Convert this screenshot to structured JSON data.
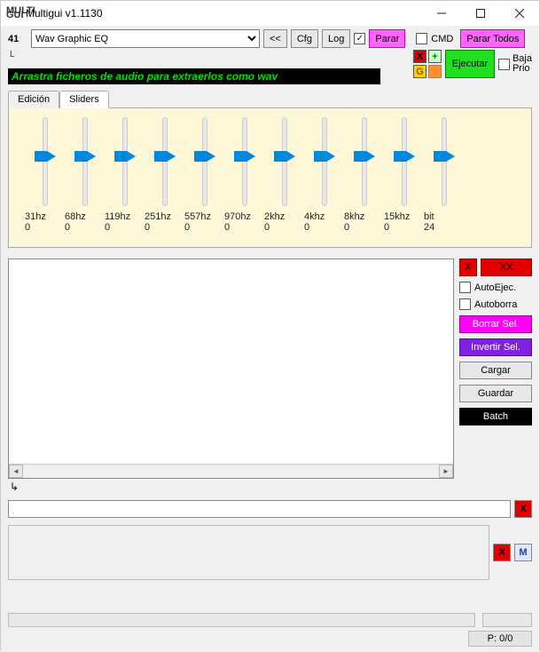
{
  "window": {
    "title": "Multigui v1.1130"
  },
  "top": {
    "num": "41",
    "preset": "Wav Graphic EQ",
    "back": "<<",
    "cfg": "Cfg",
    "log": "Log",
    "parar": "Parar",
    "cmd": "CMD",
    "parar_todos": "Parar Todos",
    "l": "L",
    "banner": "Arrastra ficheros de audio para extraerlos como wav",
    "ejecutar": "Ejecutar",
    "baja": "Baja",
    "prio": "Prio",
    "g": "G",
    "plus": "+",
    "x": "X"
  },
  "tabs": {
    "edicion": "Edición",
    "sliders": "Sliders"
  },
  "sliders": [
    {
      "freq": "31hz",
      "val": "0"
    },
    {
      "freq": "68hz",
      "val": "0"
    },
    {
      "freq": "119hz",
      "val": "0"
    },
    {
      "freq": "251hz",
      "val": "0"
    },
    {
      "freq": "557hz",
      "val": "0"
    },
    {
      "freq": "970hz",
      "val": "0"
    },
    {
      "freq": "2khz",
      "val": "0"
    },
    {
      "freq": "4khz",
      "val": "0"
    },
    {
      "freq": "8khz",
      "val": "0"
    },
    {
      "freq": "15khz",
      "val": "0"
    },
    {
      "freq": "bit",
      "val": "24"
    }
  ],
  "side": {
    "x": "X",
    "xx": "XX",
    "autoejec": "AutoEjec.",
    "autoborra": "Autoborra",
    "borrar": "Borrar Sel.",
    "invertir": "Invertir Sel.",
    "cargar": "Cargar",
    "guardar": "Guardar",
    "batch": "Batch"
  },
  "bottom": {
    "x": "X",
    "m": "M",
    "status": "P: 0/0"
  },
  "larrow": "↳"
}
